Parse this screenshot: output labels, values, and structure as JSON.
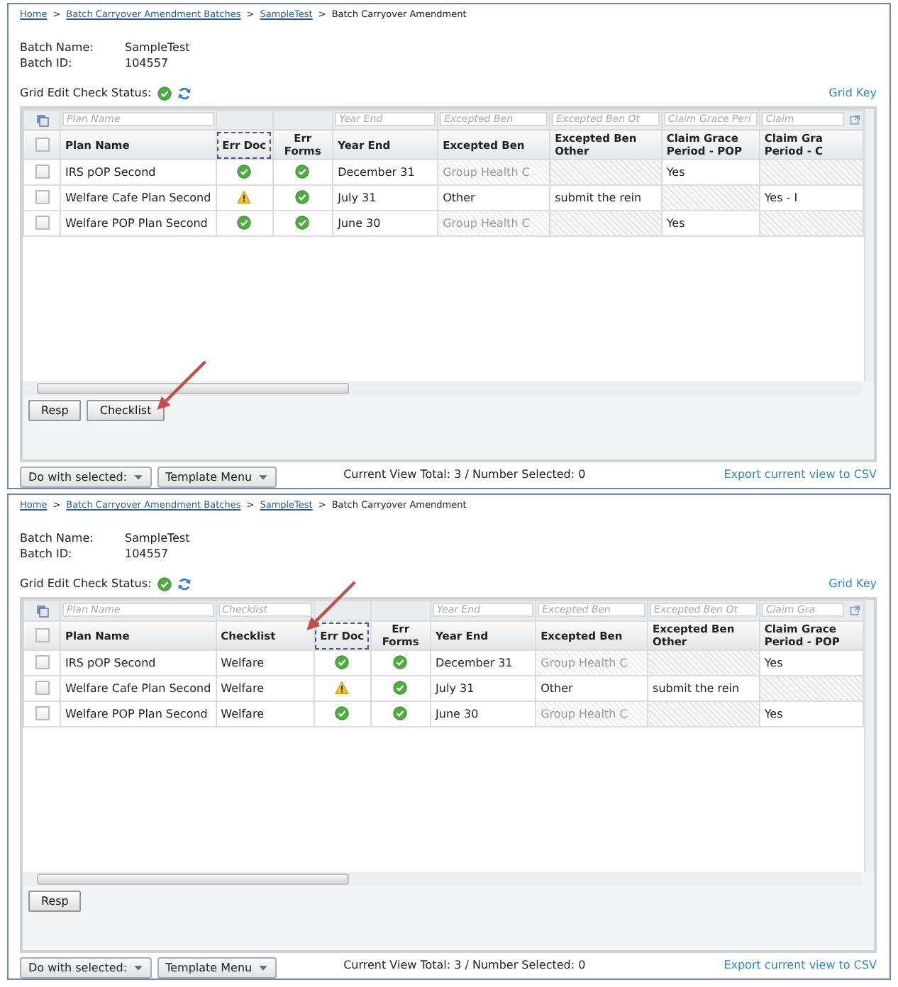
{
  "panels": [
    {
      "breadcrumb": [
        {
          "kind": "link",
          "text": "Home"
        },
        {
          "kind": "separator",
          "text": ">"
        },
        {
          "kind": "link",
          "text": "Batch Carryover Amendment Batches"
        },
        {
          "kind": "separator",
          "text": ">"
        },
        {
          "kind": "link",
          "text": "SampleTest"
        },
        {
          "kind": "separator",
          "text": ">"
        },
        {
          "kind": "current",
          "text": "Batch Carryover Amendment"
        }
      ],
      "batch": [
        {
          "label": "Batch Name:",
          "value": "SampleTest"
        },
        {
          "label": "Batch ID:",
          "value": "104557"
        }
      ],
      "status_label": "Grid Edit Check Status:",
      "grid_key": "Grid Key",
      "grid": {
        "select_all_checked": false,
        "columns": [
          {
            "kind": "name",
            "label": "Plan Name",
            "placeholder": "Plan Name",
            "focused": false,
            "callout": false
          },
          {
            "kind": "status",
            "label": "Err Doc",
            "focused": true,
            "callout": false
          },
          {
            "kind": "status",
            "label": "Err Forms",
            "focused": false,
            "callout": false
          },
          {
            "kind": "text",
            "label": "Year End",
            "placeholder": "Year End",
            "focused": false,
            "callout": false
          },
          {
            "kind": "text",
            "label": "Excepted Ben",
            "placeholder": "Excepted Ben",
            "focused": false,
            "callout": false
          },
          {
            "kind": "text",
            "label": "Excepted Ben\nOther",
            "placeholder": "Excepted Ben Ot",
            "focused": false,
            "callout": false
          },
          {
            "kind": "text",
            "label": "Claim Grace\nPeriod - POP",
            "placeholder": "Claim Grace Peri",
            "focused": false,
            "callout": false
          },
          {
            "kind": "text",
            "label": "Claim Gra\nPeriod - C",
            "placeholder": "Claim",
            "focused": false,
            "callout": false
          }
        ],
        "rows": [
          {
            "checked": false,
            "cells": [
              {
                "kind": "text",
                "text": "IRS pOP Second"
              },
              {
                "kind": "ok"
              },
              {
                "kind": "ok"
              },
              {
                "kind": "text",
                "text": "December 31"
              },
              {
                "kind": "disabled",
                "text": "Group Health C"
              },
              {
                "kind": "hatched"
              },
              {
                "kind": "text",
                "text": "Yes"
              },
              {
                "kind": "hatched"
              }
            ]
          },
          {
            "checked": false,
            "cells": [
              {
                "kind": "text",
                "text": "Welfare Cafe Plan Second"
              },
              {
                "kind": "warning"
              },
              {
                "kind": "ok"
              },
              {
                "kind": "text",
                "text": "July 31"
              },
              {
                "kind": "text",
                "text": "Other"
              },
              {
                "kind": "text",
                "text": "submit the rein"
              },
              {
                "kind": "hatched"
              },
              {
                "kind": "text",
                "text": "Yes - I"
              }
            ]
          },
          {
            "checked": false,
            "cells": [
              {
                "kind": "text",
                "text": "Welfare POP Plan Second"
              },
              {
                "kind": "ok"
              },
              {
                "kind": "ok"
              },
              {
                "kind": "text",
                "text": "June 30"
              },
              {
                "kind": "disabled",
                "text": "Group Health C"
              },
              {
                "kind": "hatched"
              },
              {
                "kind": "text",
                "text": "Yes"
              },
              {
                "kind": "hatched"
              }
            ]
          }
        ]
      },
      "buttons": [
        {
          "label": "Resp",
          "callout": false
        },
        {
          "label": "Checklist",
          "callout": true
        }
      ],
      "menus": [
        "Do with selected:",
        "Template Menu"
      ],
      "summary": "Current View Total: 3 / Number Selected: 0",
      "export": "Export current view to CSV"
    },
    {
      "breadcrumb": [
        {
          "kind": "link",
          "text": "Home"
        },
        {
          "kind": "separator",
          "text": ">"
        },
        {
          "kind": "link",
          "text": "Batch Carryover Amendment Batches"
        },
        {
          "kind": "separator",
          "text": ">"
        },
        {
          "kind": "link",
          "text": "SampleTest"
        },
        {
          "kind": "separator",
          "text": ">"
        },
        {
          "kind": "current",
          "text": "Batch Carryover Amendment"
        }
      ],
      "batch": [
        {
          "label": "Batch Name:",
          "value": "SampleTest"
        },
        {
          "label": "Batch ID:",
          "value": "104557"
        }
      ],
      "status_label": "Grid Edit Check Status:",
      "grid_key": "Grid Key",
      "grid": {
        "select_all_checked": false,
        "columns": [
          {
            "kind": "name",
            "label": "Plan Name",
            "placeholder": "Plan Name",
            "focused": false,
            "callout": false
          },
          {
            "kind": "text",
            "label": "Checklist",
            "placeholder": "Checklist",
            "focused": false,
            "callout": true
          },
          {
            "kind": "status",
            "label": "Err Doc",
            "focused": true,
            "callout": false
          },
          {
            "kind": "status",
            "label": "Err Forms",
            "focused": false,
            "callout": false
          },
          {
            "kind": "text",
            "label": "Year End",
            "placeholder": "Year End",
            "focused": false,
            "callout": false
          },
          {
            "kind": "text",
            "label": "Excepted Ben",
            "placeholder": "Excepted Ben",
            "focused": false,
            "callout": false
          },
          {
            "kind": "text",
            "label": "Excepted Ben\nOther",
            "placeholder": "Excepted Ben Ot",
            "focused": false,
            "callout": false
          },
          {
            "kind": "text",
            "label": "Claim Grace\nPeriod - POP",
            "placeholder": "Claim Gra",
            "focused": false,
            "callout": false
          }
        ],
        "rows": [
          {
            "checked": false,
            "cells": [
              {
                "kind": "text",
                "text": "IRS pOP Second"
              },
              {
                "kind": "text",
                "text": "Welfare"
              },
              {
                "kind": "ok"
              },
              {
                "kind": "ok"
              },
              {
                "kind": "text",
                "text": "December 31"
              },
              {
                "kind": "disabled",
                "text": "Group Health C"
              },
              {
                "kind": "hatched"
              },
              {
                "kind": "text",
                "text": "Yes"
              }
            ]
          },
          {
            "checked": false,
            "cells": [
              {
                "kind": "text",
                "text": "Welfare Cafe Plan Second"
              },
              {
                "kind": "text",
                "text": "Welfare"
              },
              {
                "kind": "warning"
              },
              {
                "kind": "ok"
              },
              {
                "kind": "text",
                "text": "July 31"
              },
              {
                "kind": "text",
                "text": "Other"
              },
              {
                "kind": "text",
                "text": "submit the rein"
              },
              {
                "kind": "hatched"
              }
            ]
          },
          {
            "checked": false,
            "cells": [
              {
                "kind": "text",
                "text": "Welfare POP Plan Second"
              },
              {
                "kind": "text",
                "text": "Welfare"
              },
              {
                "kind": "ok"
              },
              {
                "kind": "ok"
              },
              {
                "kind": "text",
                "text": "June 30"
              },
              {
                "kind": "disabled",
                "text": "Group Health C"
              },
              {
                "kind": "hatched"
              },
              {
                "kind": "text",
                "text": "Yes"
              }
            ]
          }
        ]
      },
      "buttons": [
        {
          "label": "Resp",
          "callout": false
        }
      ],
      "menus": [
        "Do with selected:",
        "Template Menu"
      ],
      "summary": "Current View Total: 3 / Number Selected: 0",
      "export": "Export current view to CSV"
    }
  ]
}
